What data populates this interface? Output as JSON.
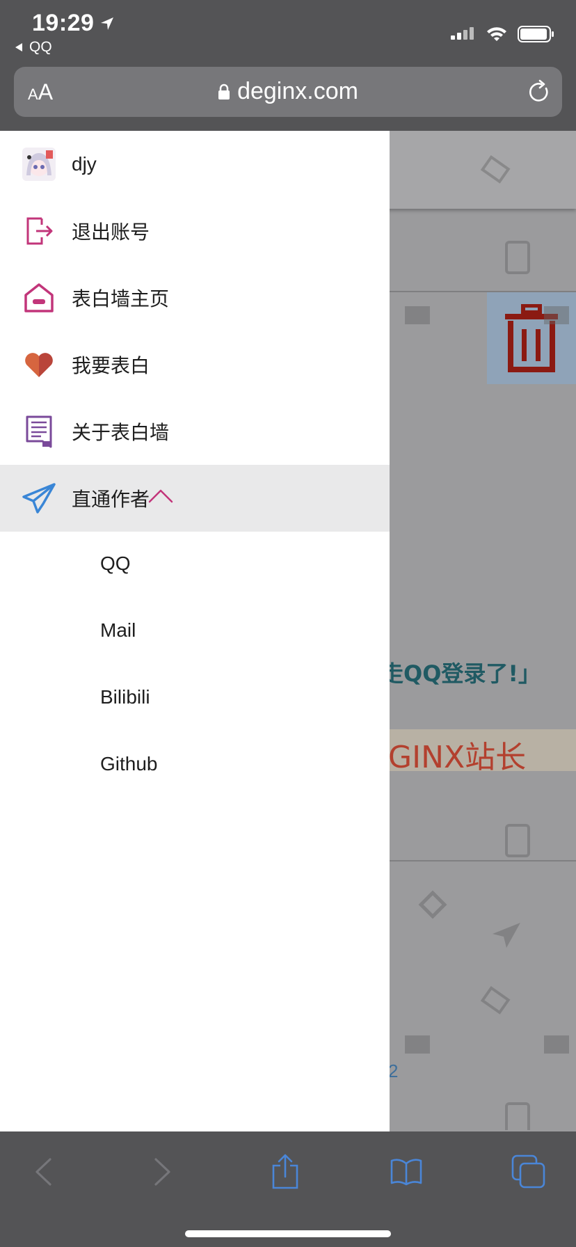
{
  "status_bar": {
    "time": "19:29",
    "back_app": "QQ"
  },
  "url_bar": {
    "text_size_label": "AA",
    "domain": "deginx.com"
  },
  "drawer": {
    "user": {
      "name": "djy"
    },
    "items": [
      {
        "label": "退出账号",
        "icon": "logout-icon",
        "color": "#c2357a"
      },
      {
        "label": "表白墙主页",
        "icon": "home-icon",
        "color": "#c2357a"
      },
      {
        "label": "我要表白",
        "icon": "heart-icon",
        "color": "#c9553b"
      },
      {
        "label": "关于表白墙",
        "icon": "book-icon",
        "color": "#7a4a9a"
      },
      {
        "label": "直通作者",
        "icon": "paper-plane-icon",
        "color": "#3a86d6",
        "expanded": true
      }
    ],
    "sub_items": [
      "QQ",
      "Mail",
      "Bilibili",
      "Github"
    ]
  },
  "background_page": {
    "snippet_text": "走QQ登录了!」",
    "banner_text": "GINX站长",
    "page_number": "2"
  },
  "colors": {
    "accent_pink": "#c2357a",
    "chrome": "#545456",
    "tab_blue": "#4a86d8"
  }
}
